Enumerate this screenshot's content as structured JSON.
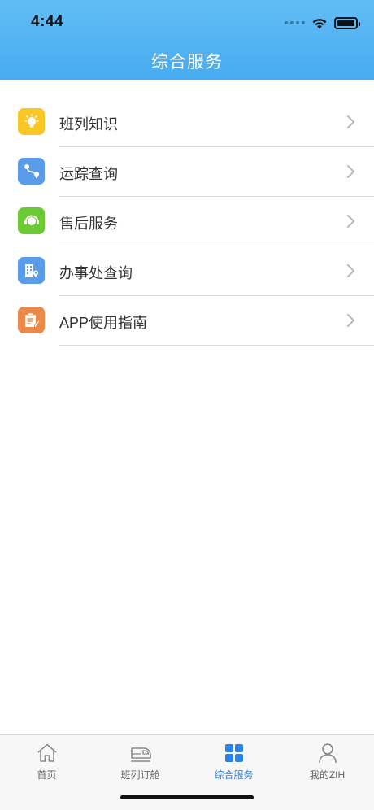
{
  "status_bar": {
    "time": "4:44"
  },
  "header": {
    "title": "综合服务"
  },
  "menu": {
    "items": [
      {
        "label": "班列知识",
        "icon": "lightbulb-icon",
        "color": "#f9c626"
      },
      {
        "label": "运踪查询",
        "icon": "route-icon",
        "color": "#5a9bea"
      },
      {
        "label": "售后服务",
        "icon": "headset-icon",
        "color": "#6ccb35"
      },
      {
        "label": "办事处查询",
        "icon": "office-location-icon",
        "color": "#5a9bea"
      },
      {
        "label": "APP使用指南",
        "icon": "guide-edit-icon",
        "color": "#e9894a"
      }
    ]
  },
  "tabbar": {
    "tabs": [
      {
        "label": "首页",
        "icon": "home-icon"
      },
      {
        "label": "班列订舱",
        "icon": "train-icon"
      },
      {
        "label": "综合服务",
        "icon": "grid-icon",
        "active": true
      },
      {
        "label": "我的ZIH",
        "icon": "user-icon"
      }
    ],
    "active_color": "#2b82e6"
  }
}
